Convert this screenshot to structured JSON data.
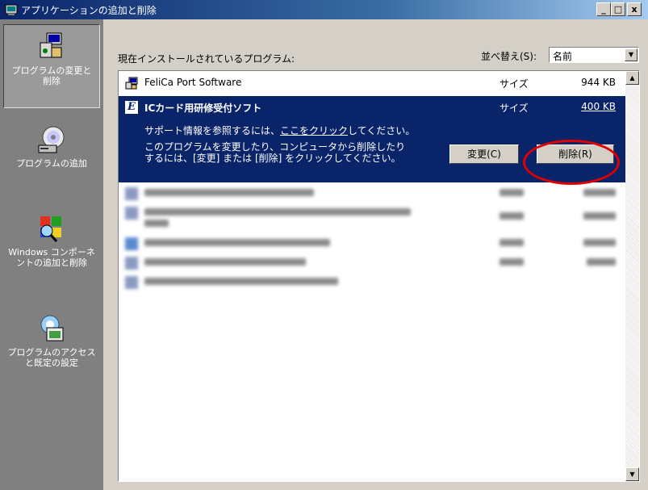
{
  "window": {
    "title": "アプリケーションの追加と削除",
    "controls": {
      "minimize": "_",
      "maximize": "□",
      "close": "x"
    }
  },
  "sidebar": {
    "items": [
      {
        "label": "プログラムの変更と削除",
        "icon": "change-remove-programs-icon",
        "active": true
      },
      {
        "label": "プログラムの追加",
        "icon": "add-programs-cd-icon",
        "active": false
      },
      {
        "label": "Windows コンポーネントの追加と削除",
        "icon": "windows-components-icon",
        "active": false
      },
      {
        "label": "プログラムのアクセスと既定の設定",
        "icon": "program-access-defaults-icon",
        "active": false
      }
    ]
  },
  "main": {
    "header_label": "現在インストールされているプログラム:",
    "sort_label": "並べ替え(S):",
    "sort_value": "名前",
    "programs": [
      {
        "name": "FeliCa Port Software",
        "size_label": "サイズ",
        "size": "944 KB",
        "icon": "installer-icon"
      }
    ],
    "selected_program": {
      "name": "ICカード用研修受付ソフト",
      "size_label": "サイズ",
      "size": "400 KB",
      "icon": "e-app-icon",
      "support_prefix": "サポート情報を参照するには、",
      "support_link": "ここをクリック",
      "support_suffix": "してください。",
      "change_text_line1": "このプログラムを変更したり、コンピュータから削除したり",
      "change_text_line2": "するには、[変更] または [削除] をクリックしてください。",
      "change_button": "変更(C)",
      "remove_button": "削除(R)"
    }
  },
  "colors": {
    "selection": "#0a246a",
    "highlight_circle": "#e00000",
    "sidebar": "#808080"
  }
}
